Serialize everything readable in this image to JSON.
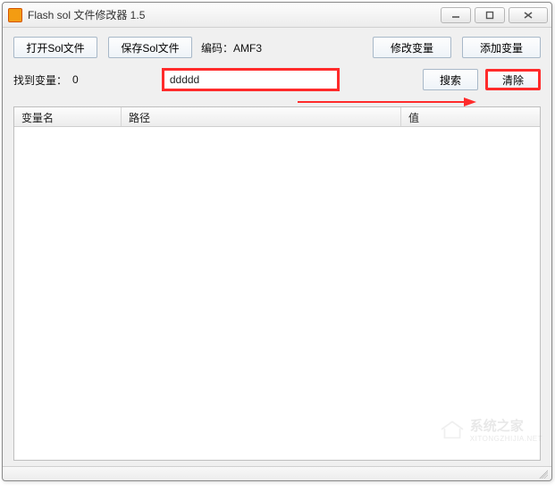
{
  "window": {
    "title": "Flash sol 文件修改器 1.5"
  },
  "toolbar": {
    "open_label": "打开Sol文件",
    "save_label": "保存Sol文件",
    "encoding_label": "编码：",
    "encoding_value": "AMF3",
    "modify_var_label": "修改变量",
    "add_var_label": "添加变量"
  },
  "search": {
    "found_label": "找到变量：",
    "found_count": "0",
    "input_value": "ddddd",
    "search_btn": "搜索",
    "clear_btn": "清除"
  },
  "table": {
    "col1": "变量名",
    "col2": "路径",
    "col3": "值",
    "rows": []
  },
  "watermark": {
    "text": "系统之家",
    "sub": "XITONGZHIJIA.NET"
  }
}
